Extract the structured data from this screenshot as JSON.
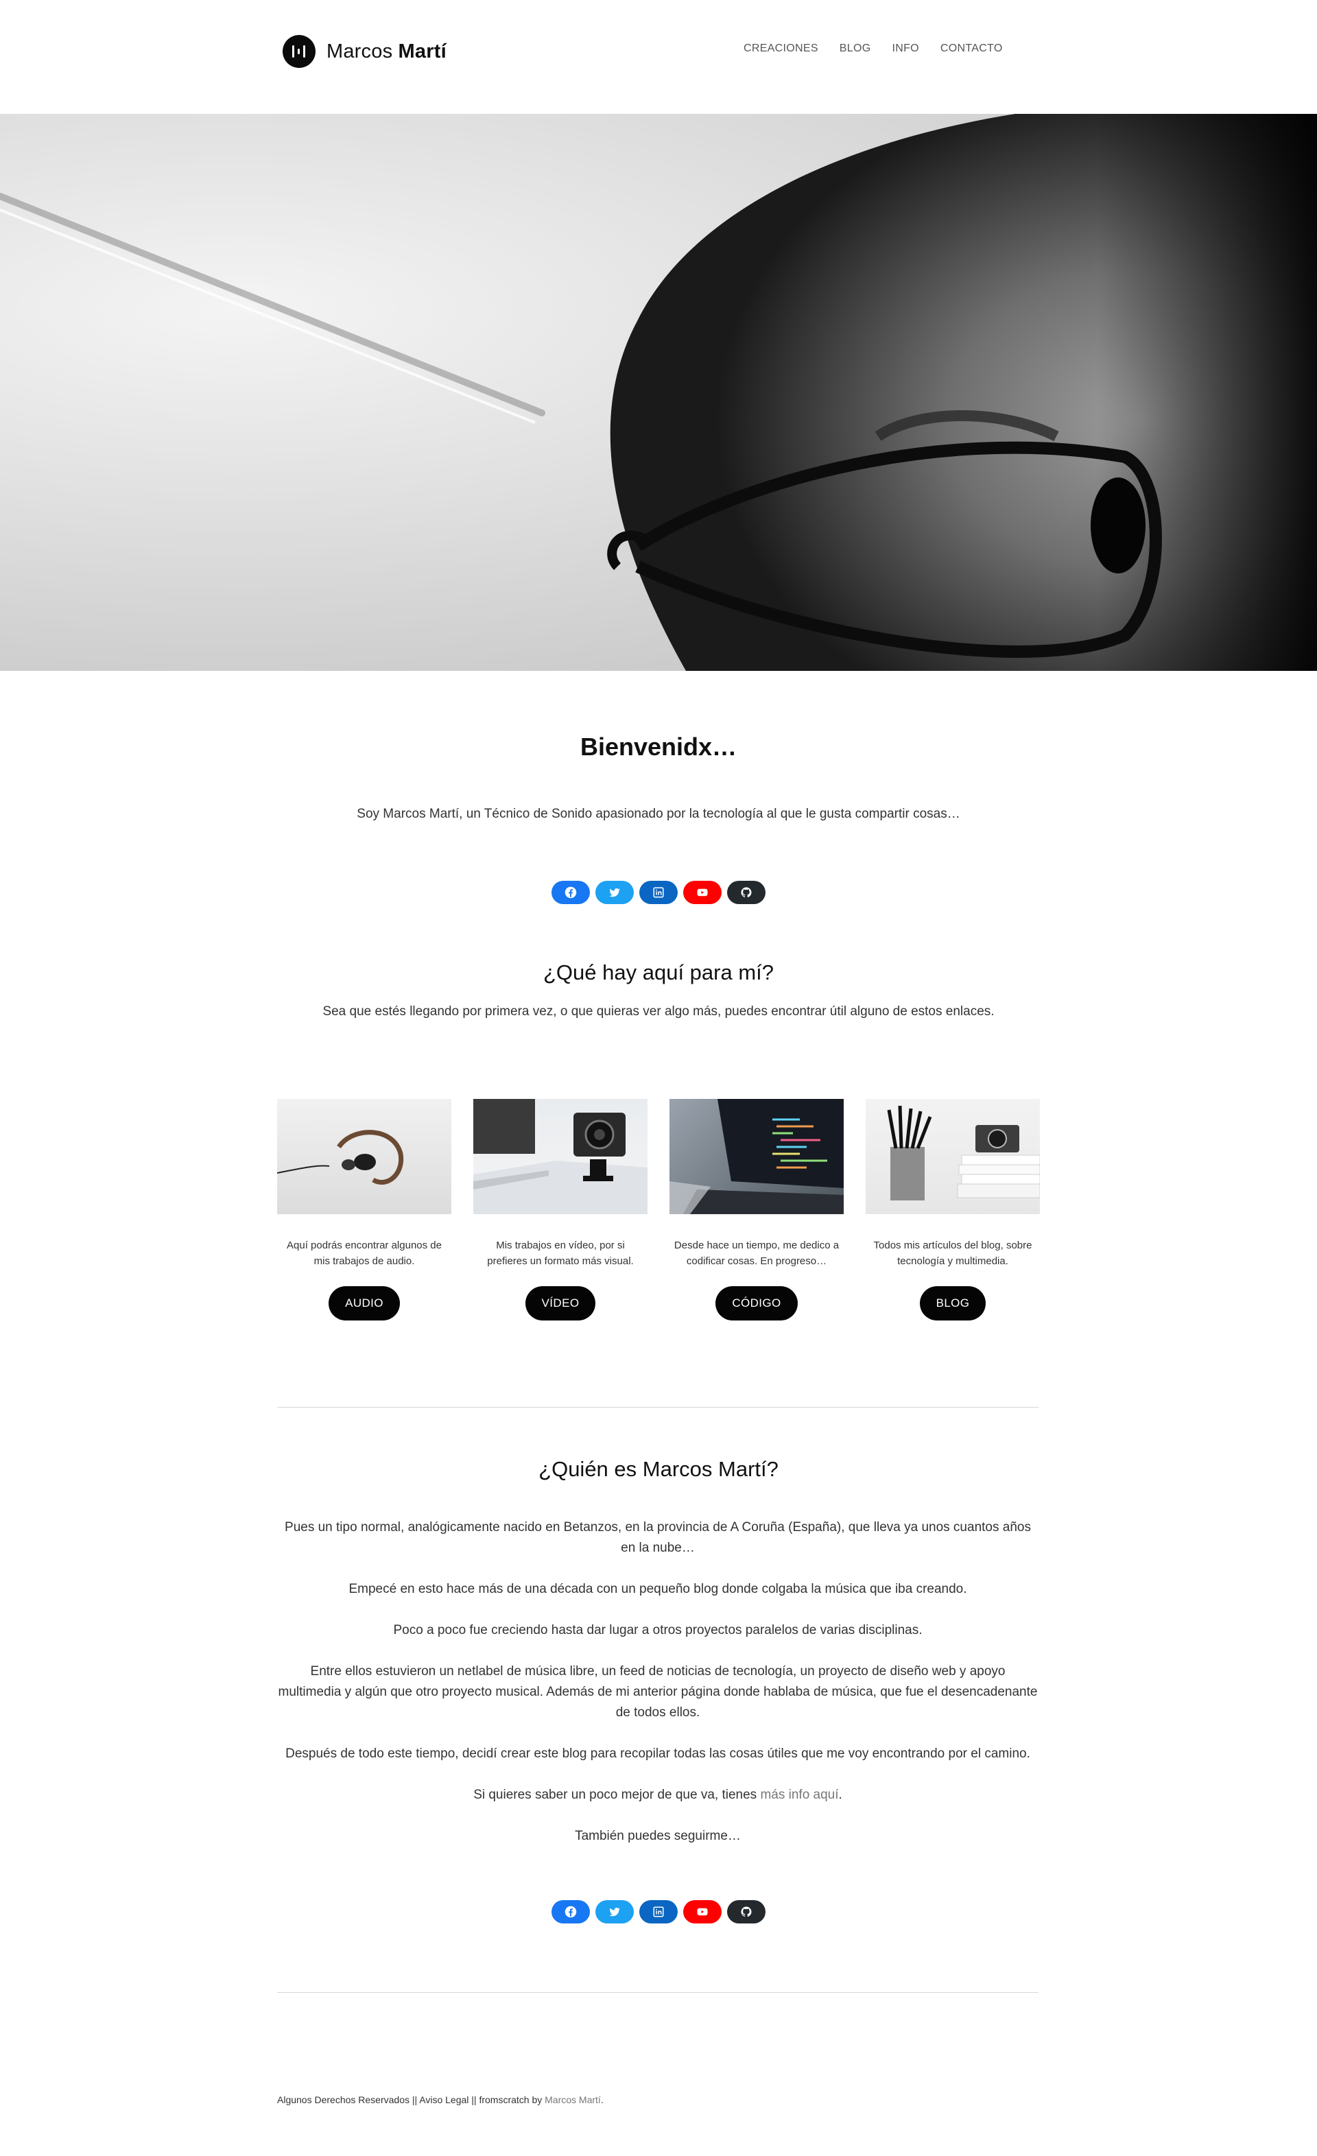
{
  "header": {
    "logo_first": "Marcos",
    "logo_last": "Martí",
    "nav": [
      "CREACIONES",
      "BLOG",
      "INFO",
      "CONTACTO"
    ]
  },
  "welcome": {
    "title": "Bienvenidx…",
    "intro": "Soy Marcos Martí, un Técnico de Sonido apasionado por la tecnología al que le gusta compartir cosas…"
  },
  "social": [
    {
      "name": "facebook",
      "color": "#1877f2",
      "icon": "facebook-icon"
    },
    {
      "name": "twitter",
      "color": "#1da1f2",
      "icon": "twitter-icon"
    },
    {
      "name": "linkedin",
      "color": "#0a66c2",
      "icon": "linkedin-icon"
    },
    {
      "name": "youtube",
      "color": "#ff0000",
      "icon": "youtube-icon"
    },
    {
      "name": "github",
      "color": "#24292e",
      "icon": "github-icon"
    }
  ],
  "links_section": {
    "title": "¿Qué hay aquí para mí?",
    "text": "Sea que estés llegando por primera vez, o que quieras ver algo más, puedes encontrar útil alguno de estos enlaces."
  },
  "cards": [
    {
      "desc": "Aquí podrás encontrar algunos de mis trabajos de audio.",
      "button": "AUDIO",
      "image": "headphones"
    },
    {
      "desc": "Mis trabajos en vídeo, por si prefieres un formato más visual.",
      "button": "VÍDEO",
      "image": "action-camera"
    },
    {
      "desc": "Desde hace un tiempo, me dedico a codificar cosas. En progreso…",
      "button": "CÓDIGO",
      "image": "laptop-code"
    },
    {
      "desc": "Todos mis artículos del blog, sobre tecnología y multimedia.",
      "button": "BLOG",
      "image": "desk-pencils"
    }
  ],
  "about": {
    "title": "¿Quién es Marcos Martí?",
    "paragraphs": [
      "Pues un tipo normal, analógicamente nacido en Betanzos, en la provincia de A Coruña (España), que lleva ya unos cuantos años en la nube…",
      "Empecé en esto hace más de una década con un pequeño blog donde colgaba la música que iba creando.",
      "Poco a poco fue creciendo hasta dar lugar a otros proyectos paralelos de varias disciplinas.",
      "Entre ellos estuvieron un netlabel de música libre, un feed de noticias de tecnología, un proyecto de diseño web y apoyo multimedia y algún que otro proyecto musical. Además de mi anterior página donde hablaba de música, que fue el desencadenante de todos ellos.",
      "Después de todo este tiempo, decidí crear este blog para recopilar todas las cosas útiles que me voy encontrando por el camino."
    ],
    "more_prefix": "Si quieres saber un poco mejor de que va, tienes ",
    "more_link": "más info aquí",
    "more_suffix": ".",
    "follow": "También puedes seguirme…"
  },
  "footer": {
    "text": "Algunos Derechos Reservados || Aviso Legal || fromscratch by ",
    "author": "Marcos Martí",
    "end": "."
  }
}
